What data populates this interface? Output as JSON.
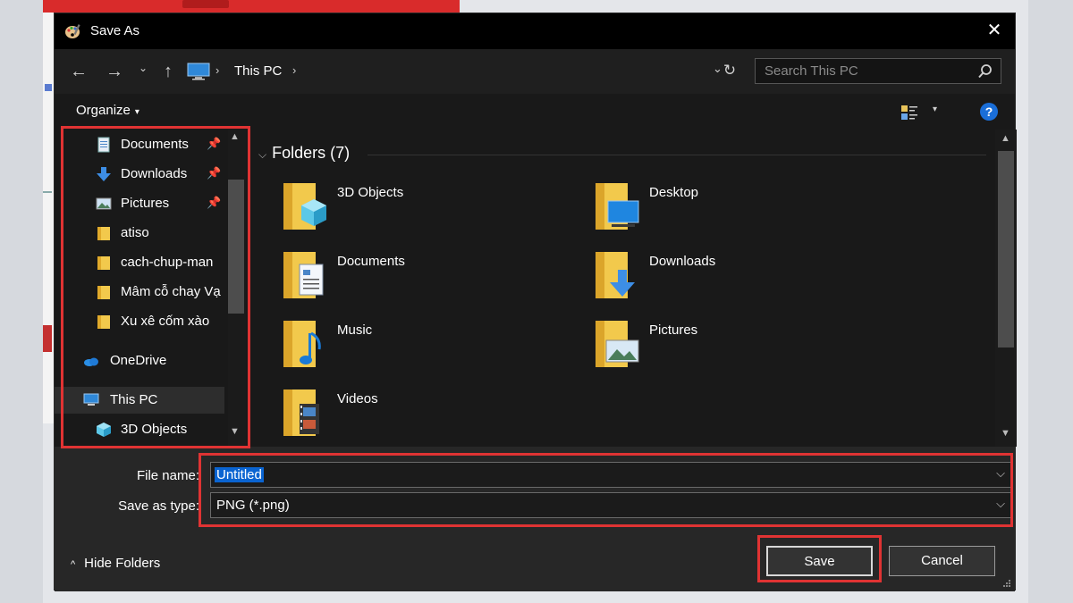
{
  "dialog": {
    "title": "Save As",
    "close_label": "✕"
  },
  "nav": {
    "back": "←",
    "forward": "→",
    "recent": "⌄",
    "up": "↑",
    "breadcrumb": "This PC",
    "separator": "›",
    "dropdown": "⌄",
    "refresh": "↻"
  },
  "search": {
    "placeholder": "Search This PC"
  },
  "toolbar": {
    "organize_label": "Organize",
    "organize_caret": "▾",
    "view_caret": "▾",
    "help_label": "?"
  },
  "sidebar": {
    "items": [
      {
        "label": "Documents",
        "icon": "documents-icon",
        "pinned": true
      },
      {
        "label": "Downloads",
        "icon": "downloads-icon",
        "pinned": true
      },
      {
        "label": "Pictures",
        "icon": "pictures-icon",
        "pinned": true
      },
      {
        "label": "atiso",
        "icon": "folder-icon",
        "pinned": false
      },
      {
        "label": "cach-chup-man",
        "icon": "folder-icon",
        "pinned": false
      },
      {
        "label": "Mâm cỗ chay Vạ",
        "icon": "folder-icon",
        "pinned": false
      },
      {
        "label": "Xu xê cốm xào",
        "icon": "folder-icon",
        "pinned": false
      },
      {
        "label": "OneDrive",
        "icon": "onedrive-icon",
        "pinned": false
      },
      {
        "label": "This PC",
        "icon": "this-pc-icon",
        "pinned": false,
        "selected": true
      },
      {
        "label": "3D Objects",
        "icon": "3d-objects-icon",
        "pinned": false
      }
    ],
    "pin_glyph": "📌"
  },
  "main": {
    "group_header": "Folders (7)",
    "group_chevron": "⌵",
    "folders": [
      {
        "label": "3D Objects",
        "icon": "3d-objects-folder-icon"
      },
      {
        "label": "Desktop",
        "icon": "desktop-folder-icon"
      },
      {
        "label": "Documents",
        "icon": "documents-folder-icon"
      },
      {
        "label": "Downloads",
        "icon": "downloads-folder-icon"
      },
      {
        "label": "Music",
        "icon": "music-folder-icon"
      },
      {
        "label": "Pictures",
        "icon": "pictures-folder-icon"
      },
      {
        "label": "Videos",
        "icon": "videos-folder-icon"
      }
    ]
  },
  "form": {
    "file_name_label": "File name:",
    "file_name_value": "Untitled",
    "save_as_type_label": "Save as type:",
    "save_as_type_value": "PNG (*.png)",
    "dropdown_arrow": "⌵"
  },
  "footer": {
    "hide_folders_caret": "^",
    "hide_folders_label": "Hide Folders",
    "save_label": "Save",
    "cancel_label": "Cancel"
  },
  "colors": {
    "dialog_bg": "#191919",
    "titlebar_bg": "#000000",
    "selection_blue": "#0a64d1",
    "highlight_red": "#e03333",
    "folder_yellow": "#f2c94c"
  }
}
